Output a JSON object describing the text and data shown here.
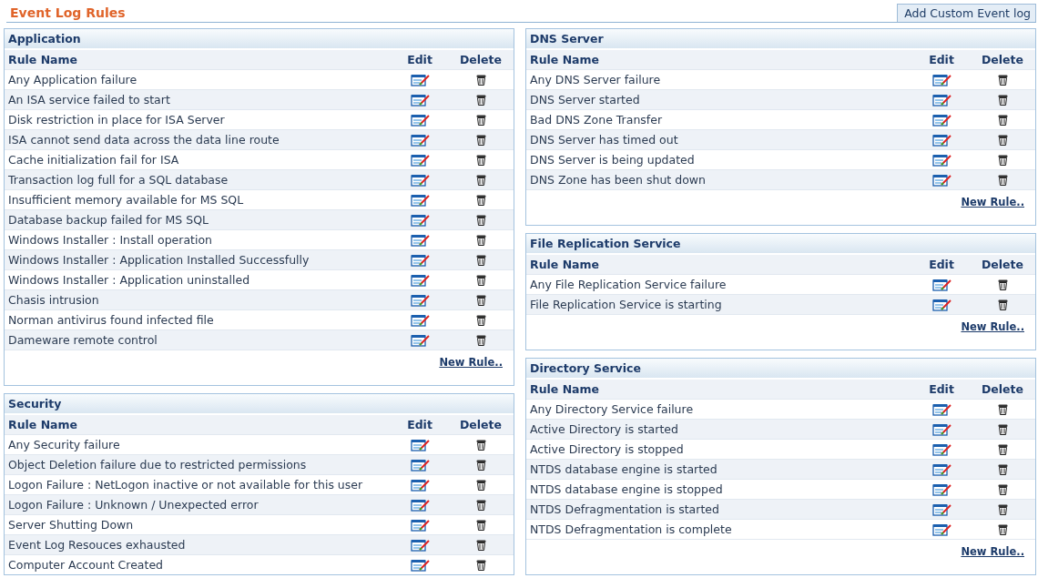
{
  "page_title": "Event Log Rules",
  "add_button": "Add Custom Event log",
  "columns": [
    {
      "panels": [
        {
          "title": "Application",
          "headers": [
            "Rule Name",
            "Edit",
            "Delete"
          ],
          "new_rule": "New Rule..",
          "rules": [
            "Any Application failure",
            "An ISA service failed to start",
            "Disk restriction in place for ISA Server",
            "ISA cannot send data across the data line route",
            "Cache initialization fail for ISA",
            "Transaction log full for a SQL database",
            "Insufficient memory available for MS SQL",
            "Database backup failed for MS SQL",
            "Windows Installer : Install operation",
            "Windows Installer : Application Installed Successfully",
            "Windows Installer : Application uninstalled",
            "Chasis intrusion",
            "Norman antivirus found infected file",
            "Dameware remote control"
          ]
        },
        {
          "title": "Security",
          "headers": [
            "Rule Name",
            "Edit",
            "Delete"
          ],
          "rules": [
            "Any Security failure",
            "Object Deletion failure due to restricted permissions",
            "Logon Failure : NetLogon inactive or not available for this user",
            "Logon Failure : Unknown / Unexpected error",
            "Server Shutting Down",
            "Event Log Resouces exhausted",
            "Computer Account Created"
          ]
        }
      ]
    },
    {
      "panels": [
        {
          "title": "DNS Server",
          "headers": [
            "Rule Name",
            "Edit",
            "Delete"
          ],
          "new_rule": "New Rule..",
          "rules": [
            "Any DNS Server failure",
            "DNS Server started",
            "Bad DNS Zone Transfer",
            "DNS Server has timed out",
            "DNS Server is being updated",
            "DNS Zone has been shut down"
          ]
        },
        {
          "title": "File Replication Service",
          "headers": [
            "Rule Name",
            "Edit",
            "Delete"
          ],
          "new_rule": "New Rule..",
          "rules": [
            "Any File Replication Service failure",
            "File Replication Service is starting"
          ]
        },
        {
          "title": "Directory Service",
          "headers": [
            "Rule Name",
            "Edit",
            "Delete"
          ],
          "new_rule": "New Rule..",
          "rules": [
            "Any Directory Service failure",
            "Active Directory is started",
            "Active Directory is stopped",
            "NTDS database engine is started",
            "NTDS database engine is stopped",
            "NTDS Defragmentation is started",
            "NTDS Defragmentation is complete"
          ]
        }
      ]
    }
  ]
}
